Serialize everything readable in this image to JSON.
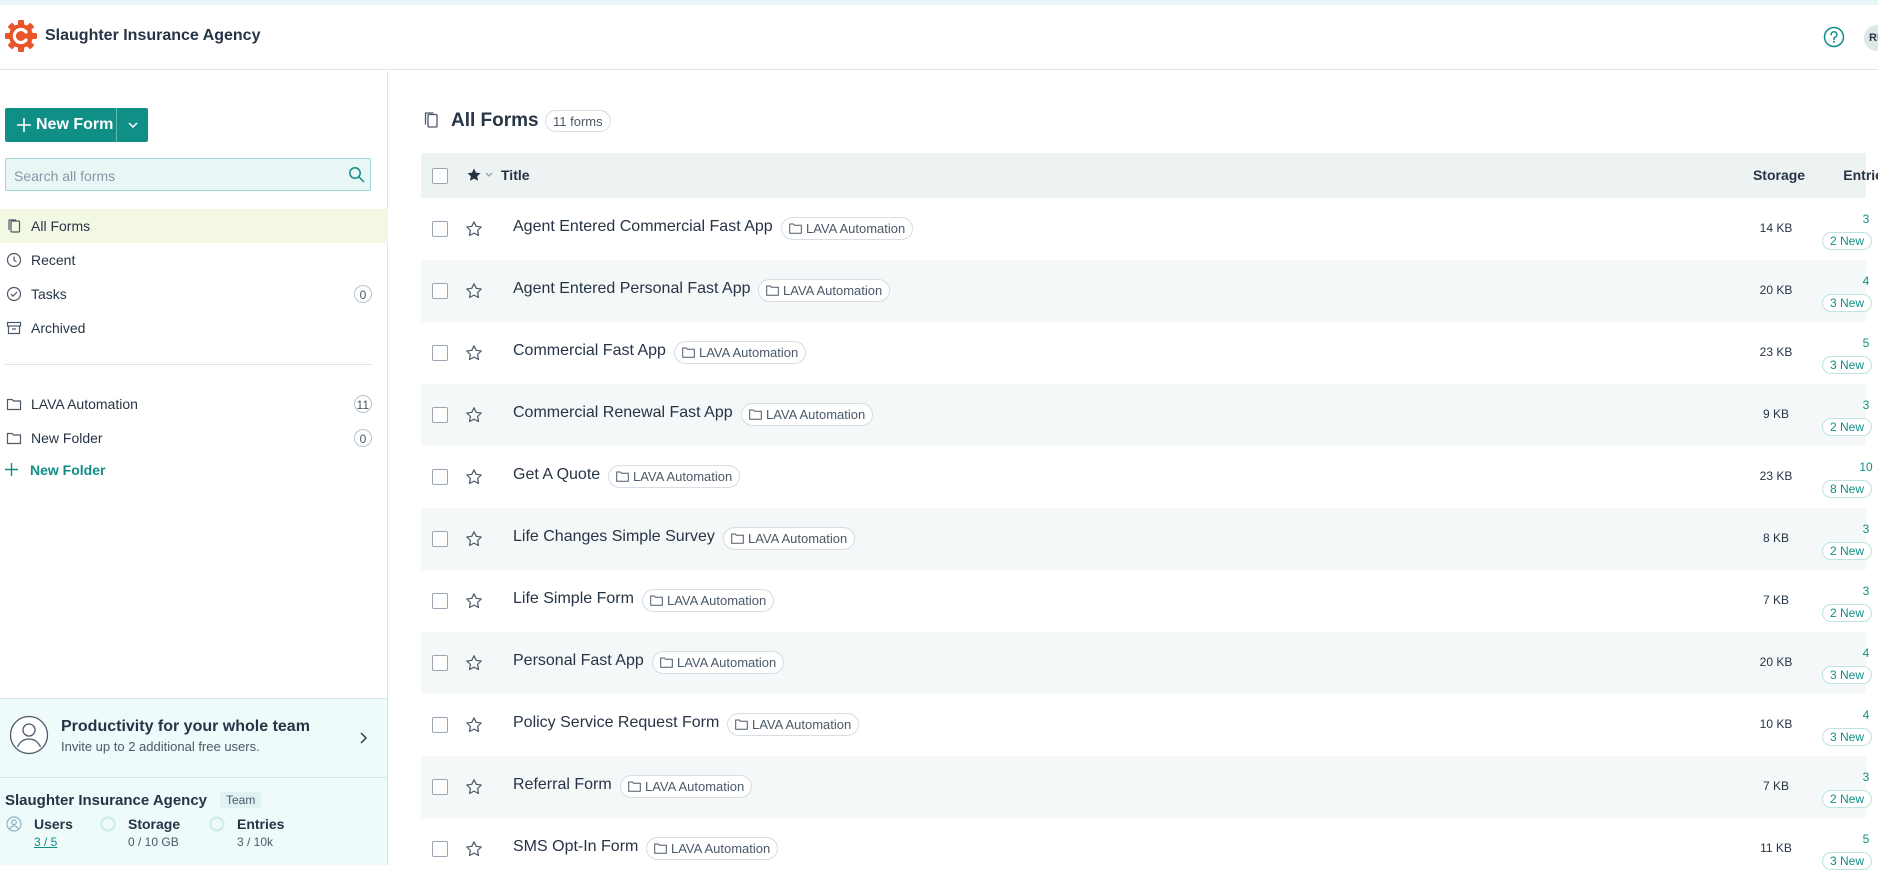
{
  "header": {
    "brand": "Slaughter Insurance Agency",
    "avatar_initials": "RH"
  },
  "sidebar": {
    "new_form_label": "New Form",
    "search_placeholder": "Search all forms",
    "nav": [
      {
        "label": "All Forms",
        "icon": "copy-icon"
      },
      {
        "label": "Recent",
        "icon": "clock-icon"
      },
      {
        "label": "Tasks",
        "icon": "check-circle-icon",
        "count": "0"
      },
      {
        "label": "Archived",
        "icon": "archive-icon"
      }
    ],
    "folders": [
      {
        "label": "LAVA Automation",
        "count": "11"
      },
      {
        "label": "New Folder",
        "count": "0"
      }
    ],
    "new_folder_label": "New Folder",
    "promo": {
      "title": "Productivity for your whole team",
      "subtitle": "Invite up to 2 additional free users."
    },
    "plan": {
      "name": "Slaughter Insurance Agency",
      "tier": "Team",
      "users": {
        "label": "Users",
        "value": "3 / 5"
      },
      "storage": {
        "label": "Storage",
        "value": "0 / 10 GB"
      },
      "entries": {
        "label": "Entries",
        "value": "3 / 10k"
      }
    }
  },
  "main": {
    "title": "All Forms",
    "count_label": "11 forms",
    "columns": {
      "title": "Title",
      "storage": "Storage",
      "entries": "Entries"
    },
    "rows": [
      {
        "title": "Agent Entered Commercial Fast App",
        "folder": "LAVA Automation",
        "storage": "14 KB",
        "entries": "3",
        "new": "2 New"
      },
      {
        "title": "Agent Entered Personal Fast App",
        "folder": "LAVA Automation",
        "storage": "20 KB",
        "entries": "4",
        "new": "3 New"
      },
      {
        "title": "Commercial Fast App",
        "folder": "LAVA Automation",
        "storage": "23 KB",
        "entries": "5",
        "new": "3 New"
      },
      {
        "title": "Commercial Renewal Fast App",
        "folder": "LAVA Automation",
        "storage": "9 KB",
        "entries": "3",
        "new": "2 New"
      },
      {
        "title": "Get A Quote",
        "folder": "LAVA Automation",
        "storage": "23 KB",
        "entries": "10",
        "new": "8 New"
      },
      {
        "title": "Life Changes Simple Survey",
        "folder": "LAVA Automation",
        "storage": "8 KB",
        "entries": "3",
        "new": "2 New"
      },
      {
        "title": "Life Simple Form",
        "folder": "LAVA Automation",
        "storage": "7 KB",
        "entries": "3",
        "new": "2 New"
      },
      {
        "title": "Personal Fast App",
        "folder": "LAVA Automation",
        "storage": "20 KB",
        "entries": "4",
        "new": "3 New"
      },
      {
        "title": "Policy Service Request Form",
        "folder": "LAVA Automation",
        "storage": "10 KB",
        "entries": "4",
        "new": "3 New"
      },
      {
        "title": "Referral Form",
        "folder": "LAVA Automation",
        "storage": "7 KB",
        "entries": "3",
        "new": "2 New"
      },
      {
        "title": "SMS Opt-In Form",
        "folder": "LAVA Automation",
        "storage": "11 KB",
        "entries": "5",
        "new": "3 New"
      }
    ]
  },
  "colors": {
    "accent": "#0f8f86",
    "brand_logo": "#e8552b",
    "active_nav_bg": "#f3f8e4"
  }
}
